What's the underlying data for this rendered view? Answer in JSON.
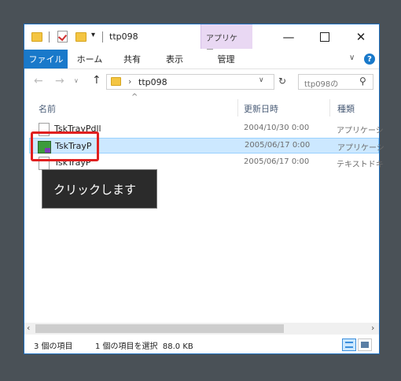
{
  "window": {
    "title": "ttp098",
    "context_tab": "アプリケー...",
    "minimize_icon": "minimize-icon",
    "maximize_icon": "maximize-icon",
    "close_icon": "close-icon"
  },
  "ribbon": {
    "tabs": [
      "ファイル",
      "ホーム",
      "共有",
      "表示"
    ],
    "context_subtab": "管理",
    "help_label": "?"
  },
  "address": {
    "path": "ttp098",
    "search_placeholder": "ttp098の"
  },
  "columns": [
    "名前",
    "更新日時",
    "種類"
  ],
  "files": [
    {
      "name": "TskTrayPdll",
      "date": "2004/10/30 0:00",
      "type": "アプリケーシ",
      "icon": "dll-icon"
    },
    {
      "name": "TskTrayP",
      "date": "2005/06/17 0:00",
      "type": "アプリケーシ",
      "icon": "exe-icon",
      "selected": true
    },
    {
      "name": "TskTrayP",
      "date": "2005/06/17 0:00",
      "type": "テキストドキ",
      "icon": "text-file-icon"
    }
  ],
  "tooltip": "クリックします",
  "status": {
    "item_count": "3 個の項目",
    "selection": "1 個の項目を選択  88.0 KB"
  },
  "colors": {
    "accent": "#1979ca",
    "selection": "#cce8ff",
    "highlight": "#e02020",
    "context_tab": "#e9d8f3"
  }
}
